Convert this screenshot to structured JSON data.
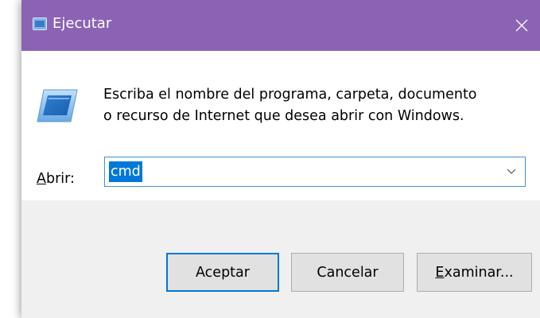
{
  "window": {
    "title": "Ejecutar",
    "accent_color": "#8b63b5",
    "close_icon": "close-icon"
  },
  "content": {
    "description_line1": "Escriba el nombre del programa, carpeta, documento",
    "description_line2": "o recurso de Internet que desea abrir con Windows.",
    "open_label_accel": "A",
    "open_label_rest": "brir:",
    "open_value": "cmd",
    "selection_color": "#0078d7"
  },
  "buttons": {
    "ok_label": "Aceptar",
    "cancel_label": "Cancelar",
    "browse_accel": "E",
    "browse_rest": "xaminar..."
  }
}
